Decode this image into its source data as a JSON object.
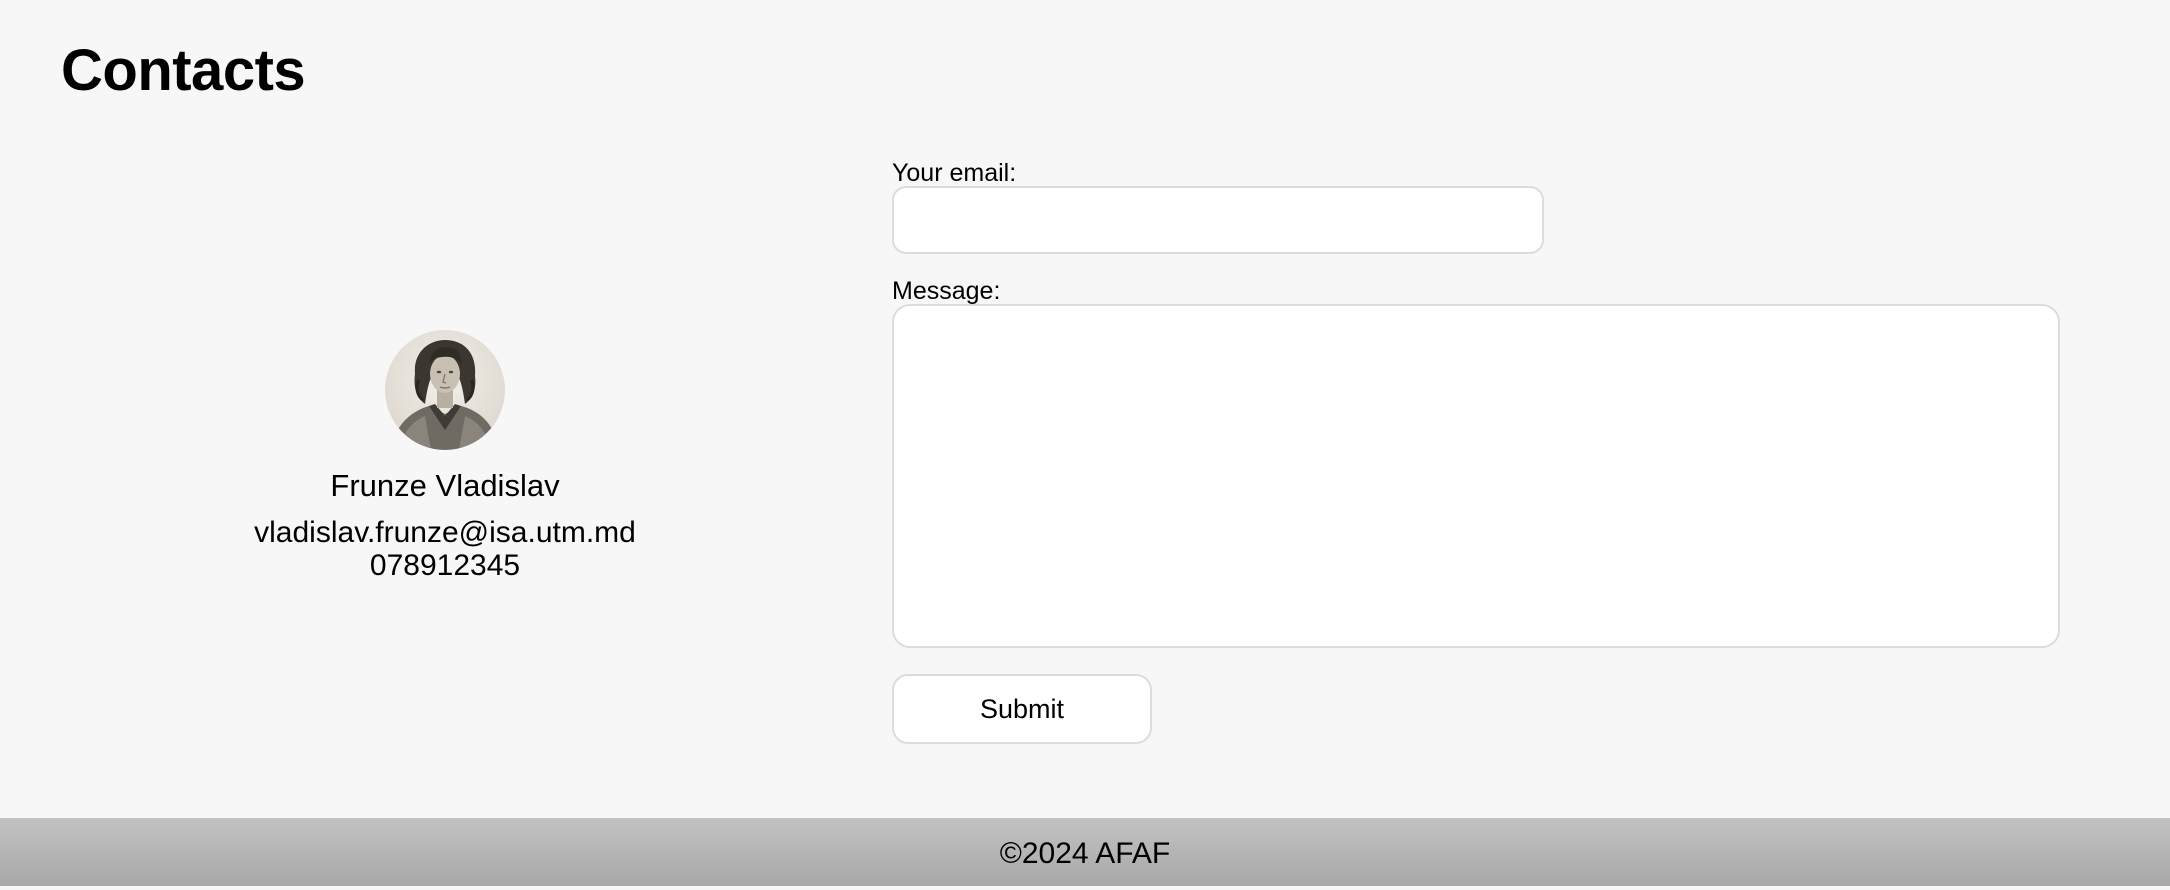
{
  "header": {
    "title": "Contacts"
  },
  "contact": {
    "avatar_icon": "portrait-avatar",
    "name": "Frunze Vladislav",
    "email": "vladislav.frunze@isa.utm.md",
    "phone": "078912345"
  },
  "form": {
    "email_label": "Your email:",
    "email_value": "",
    "email_placeholder": "",
    "message_label": "Message:",
    "message_value": "",
    "message_placeholder": "",
    "submit_label": "Submit"
  },
  "footer": {
    "text": "©2024 AFAF"
  },
  "colors": {
    "background": "#f7f7f7",
    "input_border": "#dcdcdc",
    "footer_top": "#c2c2c2",
    "footer_bottom": "#a8a8a8"
  }
}
